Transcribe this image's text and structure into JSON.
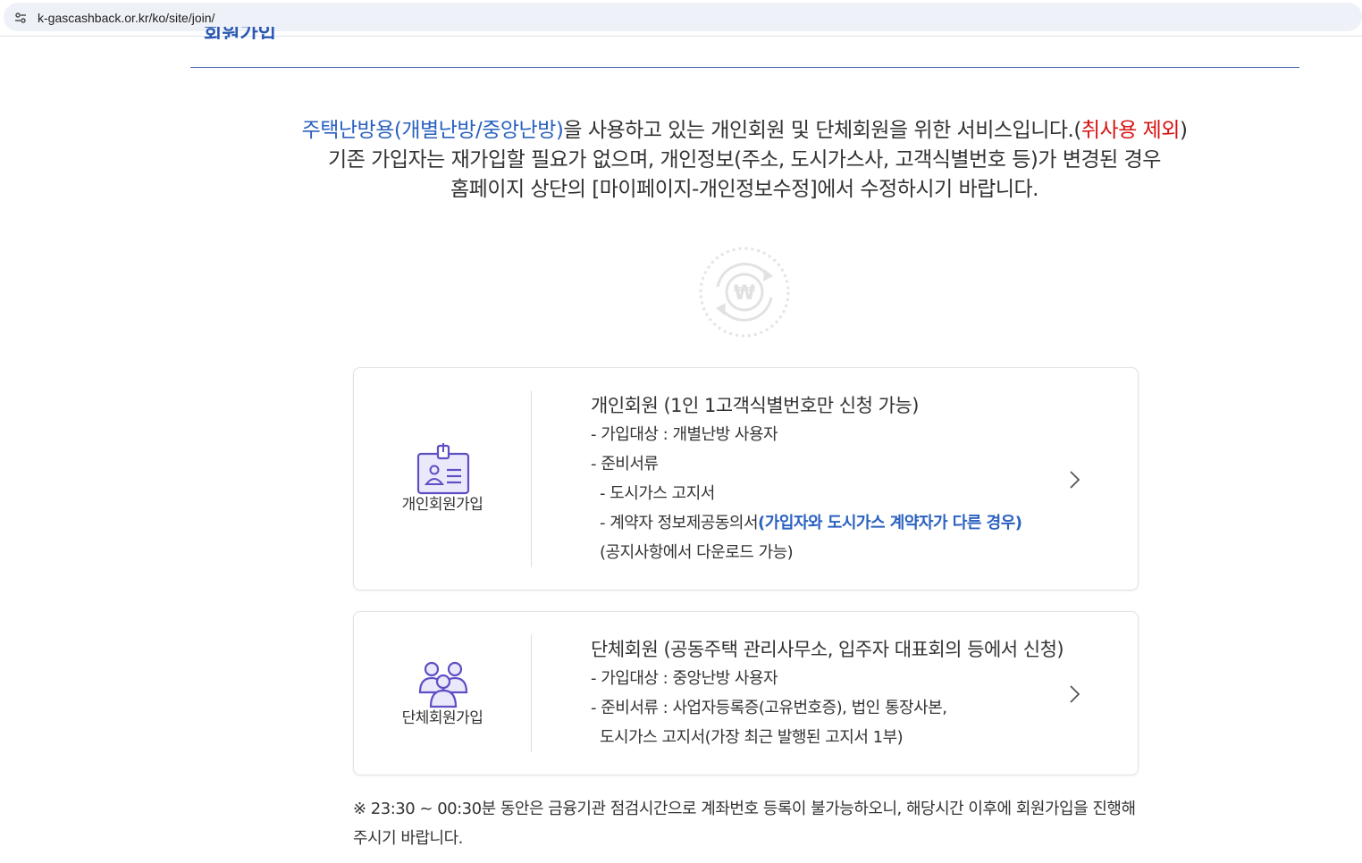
{
  "browser": {
    "url": "k-gascashback.or.kr/ko/site/join/"
  },
  "page": {
    "cut_title": "회원가입"
  },
  "intro": {
    "line1_blue": "주택난방용(개별난방/중앙난방)",
    "line1_mid": "을 사용하고 있는 개인회원 및 단체회원을 위한 서비스입니다.(",
    "line1_red": "취사용 제외",
    "line1_end": ")",
    "line2": "기존 가입자는 재가입할 필요가 없으며, 개인정보(주소, 도시가스사, 고객식별번호 등)가 변경된 경우",
    "line3": "홈페이지 상단의 [마이페이지-개인정보수정]에서 수정하시기 바랍니다."
  },
  "personal_card": {
    "icon": "id-card-icon",
    "label": "개인회원가입",
    "title": "개인회원 (1인 1고객식별번호만 신청 가능)",
    "target": "- 가입대상 : 개별난방 사용자",
    "docs": "- 준비서류",
    "doc1": "- 도시가스 고지서",
    "doc2_prefix": "- 계약자 정보제공동의서",
    "doc2_blue": "(가입자와 도시가스 계약자가 다른 경우)",
    "doc2_note": "(공지사항에서 다운로드 가능)",
    "arrow_icon": "chevron-right-icon"
  },
  "group_card": {
    "icon": "group-people-icon",
    "label": "단체회원가입",
    "title": "단체회원 (공동주택 관리사무소, 입주자 대표회의 등에서 신청)",
    "target": "- 가입대상 : 중앙난방 사용자",
    "docs": "- 준비서류 : 사업자등록증(고유번호증), 법인 통장사본,",
    "docs_cont": "도시가스 고지서(가장 최근 발행된 고지서 1부)",
    "arrow_icon": "chevron-right-icon"
  },
  "notice": {
    "text": "※ 23:30 ~ 00:30분 동안은 금융기관 점검시간으로 계좌번호 등록이 불가능하오니, 해당시간 이후에 회원가입을 진행해주시기 바랍니다."
  },
  "colors": {
    "accent_blue": "#2b62c0",
    "accent_red": "#d81212",
    "icon_purple": "#5d4fc4",
    "divider_blue": "#4b6bb5"
  }
}
